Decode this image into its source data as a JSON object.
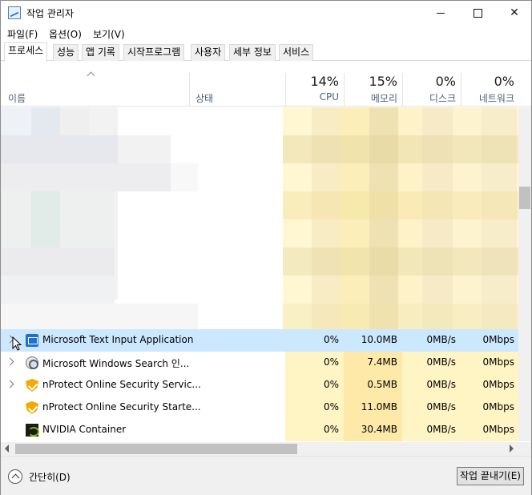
{
  "window": {
    "title": "작업 관리자"
  },
  "menu": [
    "파일(F)",
    "옵션(O)",
    "보기(V)"
  ],
  "tabs": [
    "프로세스",
    "성능",
    "앱 기록",
    "시작프로그램",
    "사용자",
    "세부 정보",
    "서비스"
  ],
  "columns": {
    "name": "이름",
    "status": "상태",
    "cpu": {
      "label": "CPU",
      "percent": "14%"
    },
    "memory": {
      "label": "메모리",
      "percent": "15%"
    },
    "disk": {
      "label": "디스크",
      "percent": "0%"
    },
    "network": {
      "label": "네트워크",
      "percent": "0%"
    }
  },
  "processes": [
    {
      "name": "Microsoft Text Input Application",
      "icon": "keyboard-icon",
      "cpu": "0%",
      "memory": "10.0MB",
      "disk": "0MB/s",
      "network": "0Mbps",
      "selected": true
    },
    {
      "name": "Microsoft Windows Search 인...",
      "icon": "search-indexer-icon",
      "cpu": "0%",
      "memory": "7.4MB",
      "disk": "0MB/s",
      "network": "0Mbps"
    },
    {
      "name": "nProtect Online Security Servic...",
      "icon": "shield-icon",
      "cpu": "0%",
      "memory": "0.5MB",
      "disk": "0MB/s",
      "network": "0Mbps"
    },
    {
      "name": "nProtect Online Security Starte...",
      "icon": "shield-icon",
      "cpu": "0%",
      "memory": "11.0MB",
      "disk": "0MB/s",
      "network": "0Mbps"
    },
    {
      "name": "NVIDIA Container",
      "icon": "nvidia-icon",
      "cpu": "0%",
      "memory": "30.4MB",
      "disk": "0MB/s",
      "network": "0Mbps"
    }
  ],
  "footer": {
    "fewer_details": "간단히(D)",
    "end_task": "작업 끝내기(E)"
  },
  "colors": {
    "selected_row": "#cce8ff",
    "heat_light": "#fff4c4",
    "heat_medium": "#ffe9a8"
  }
}
